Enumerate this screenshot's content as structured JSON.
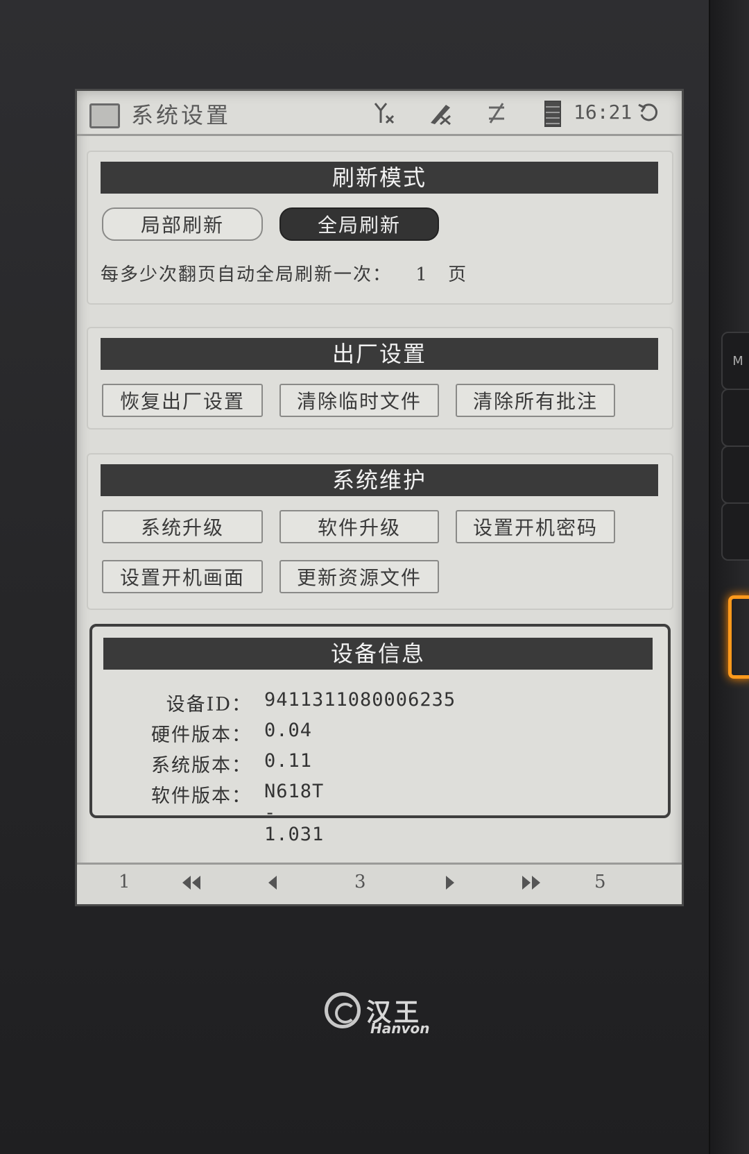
{
  "statusbar": {
    "title": "系统设置",
    "time": "16:21",
    "icons": [
      "document-icon",
      "antenna-off-icon",
      "pen-off-icon",
      "sync-off-icon",
      "battery-icon",
      "refresh-icon"
    ]
  },
  "refresh_mode": {
    "header": "刷新模式",
    "partial_label": "局部刷新",
    "full_label": "全局刷新",
    "selected": "全局刷新",
    "interval_text": "每多少次翻页自动全局刷新一次：",
    "interval_value": "1",
    "interval_unit": "页"
  },
  "factory": {
    "header": "出厂设置",
    "buttons": [
      "恢复出厂设置",
      "清除临时文件",
      "清除所有批注"
    ]
  },
  "maintenance": {
    "header": "系统维护",
    "buttons": [
      "系统升级",
      "软件升级",
      "设置开机密码",
      "设置开机画面",
      "更新资源文件"
    ]
  },
  "device_info": {
    "header": "设备信息",
    "rows": [
      {
        "label": "设备ID：",
        "value": "9411311080006235"
      },
      {
        "label": "硬件版本：",
        "value": "0.04"
      },
      {
        "label": "系统版本：",
        "value": "0.11"
      },
      {
        "label": "软件版本：",
        "value": "N618T - 1.031"
      }
    ]
  },
  "pagination": {
    "first": "1",
    "current": "3",
    "last": "5"
  },
  "brand": {
    "cn": "汉王",
    "en": "Hanvon"
  },
  "side_button_label": "M",
  "colors": {
    "screen_bg": "#dcdcd8",
    "header_bg": "#3a3a3a",
    "bezel": "#2b2b2d",
    "side_light": "#ff9a1c"
  }
}
